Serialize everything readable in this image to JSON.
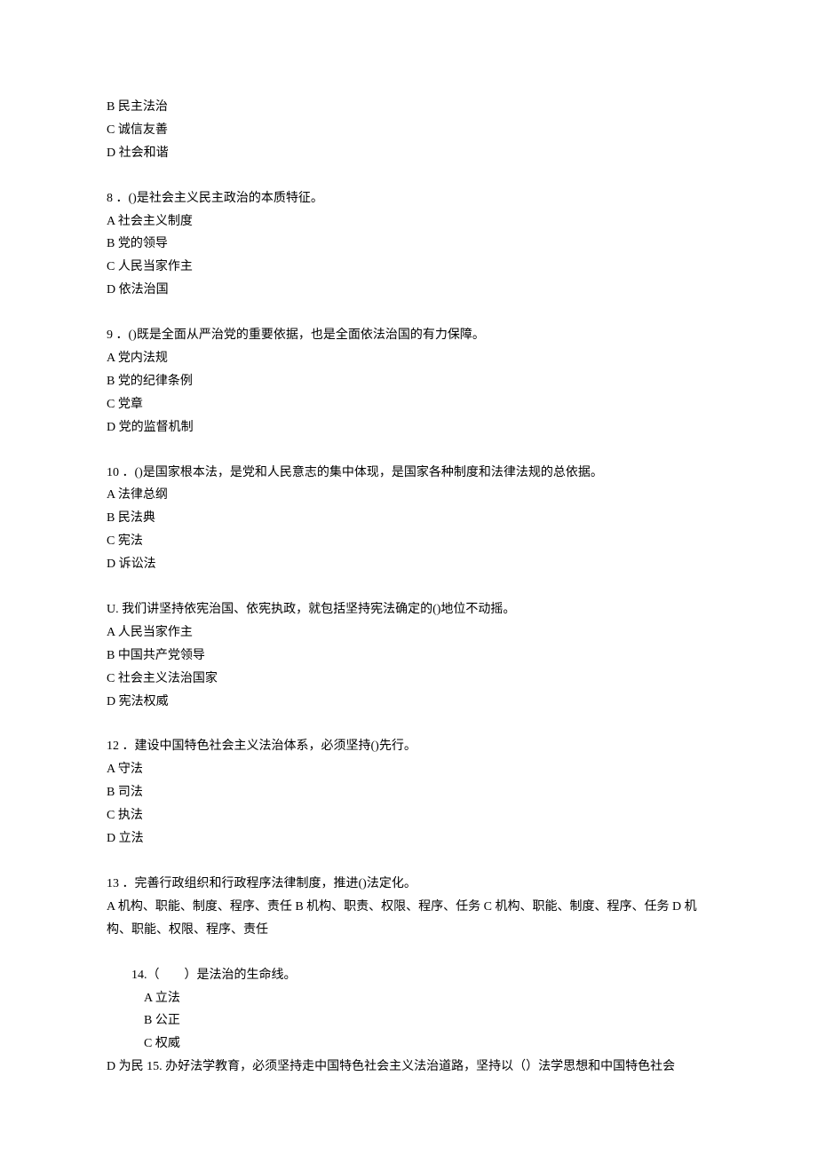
{
  "q7_remainder": {
    "b": "B 民主法治",
    "c": "C 诚信友善",
    "d": "D 社会和谐"
  },
  "q8": {
    "stem": "8 ．()是社会主义民主政治的本质特征。",
    "a": "A 社会主义制度",
    "b": "B 党的领导",
    "c": "C 人民当家作主",
    "d": "D 依法治国"
  },
  "q9": {
    "stem": "9 ．()既是全面从严治党的重要依据，也是全面依法治国的有力保障。",
    "a": "A 党内法规",
    "b": "B 党的纪律条例",
    "c": "C 党章",
    "d": "D 党的监督机制"
  },
  "q10": {
    "stem": "10 ．()是国家根本法，是党和人民意志的集中体现，是国家各种制度和法律法规的总依据。",
    "a": "A 法律总纲",
    "b": "B 民法典",
    "c": "C 宪法",
    "d": "D 诉讼法"
  },
  "q11": {
    "stem": "U. 我们讲坚持依宪治国、依宪执政，就包括坚持宪法确定的()地位不动摇。",
    "a": "A 人民当家作主",
    "b": "B 中国共产党领导",
    "c": "C 社会主义法治国家",
    "d": "D 宪法权威"
  },
  "q12": {
    "stem": "12 ．建设中国特色社会主义法治体系，必须坚持()先行。",
    "a": "A 守法",
    "b": "B 司法",
    "c": "C 执法",
    "d": "D 立法"
  },
  "q13": {
    "stem": "13 ．完善行政组织和行政程序法律制度，推进()法定化。",
    "opts": "A 机构、职能、制度、程序、责任 B 机构、职责、权限、程序、任务 C 机构、职能、制度、程序、任务 D 机构、职能、权限、程序、责任"
  },
  "q14": {
    "stem": "14.（　　）是法治的生命线。",
    "a": "A 立法",
    "b": "B 公正",
    "c": "C 权威"
  },
  "q15": {
    "combo": "D 为民 15. 办好法学教育，必须坚持走中国特色社会主义法治道路，坚持以（）法学思想和中国特色社会"
  }
}
